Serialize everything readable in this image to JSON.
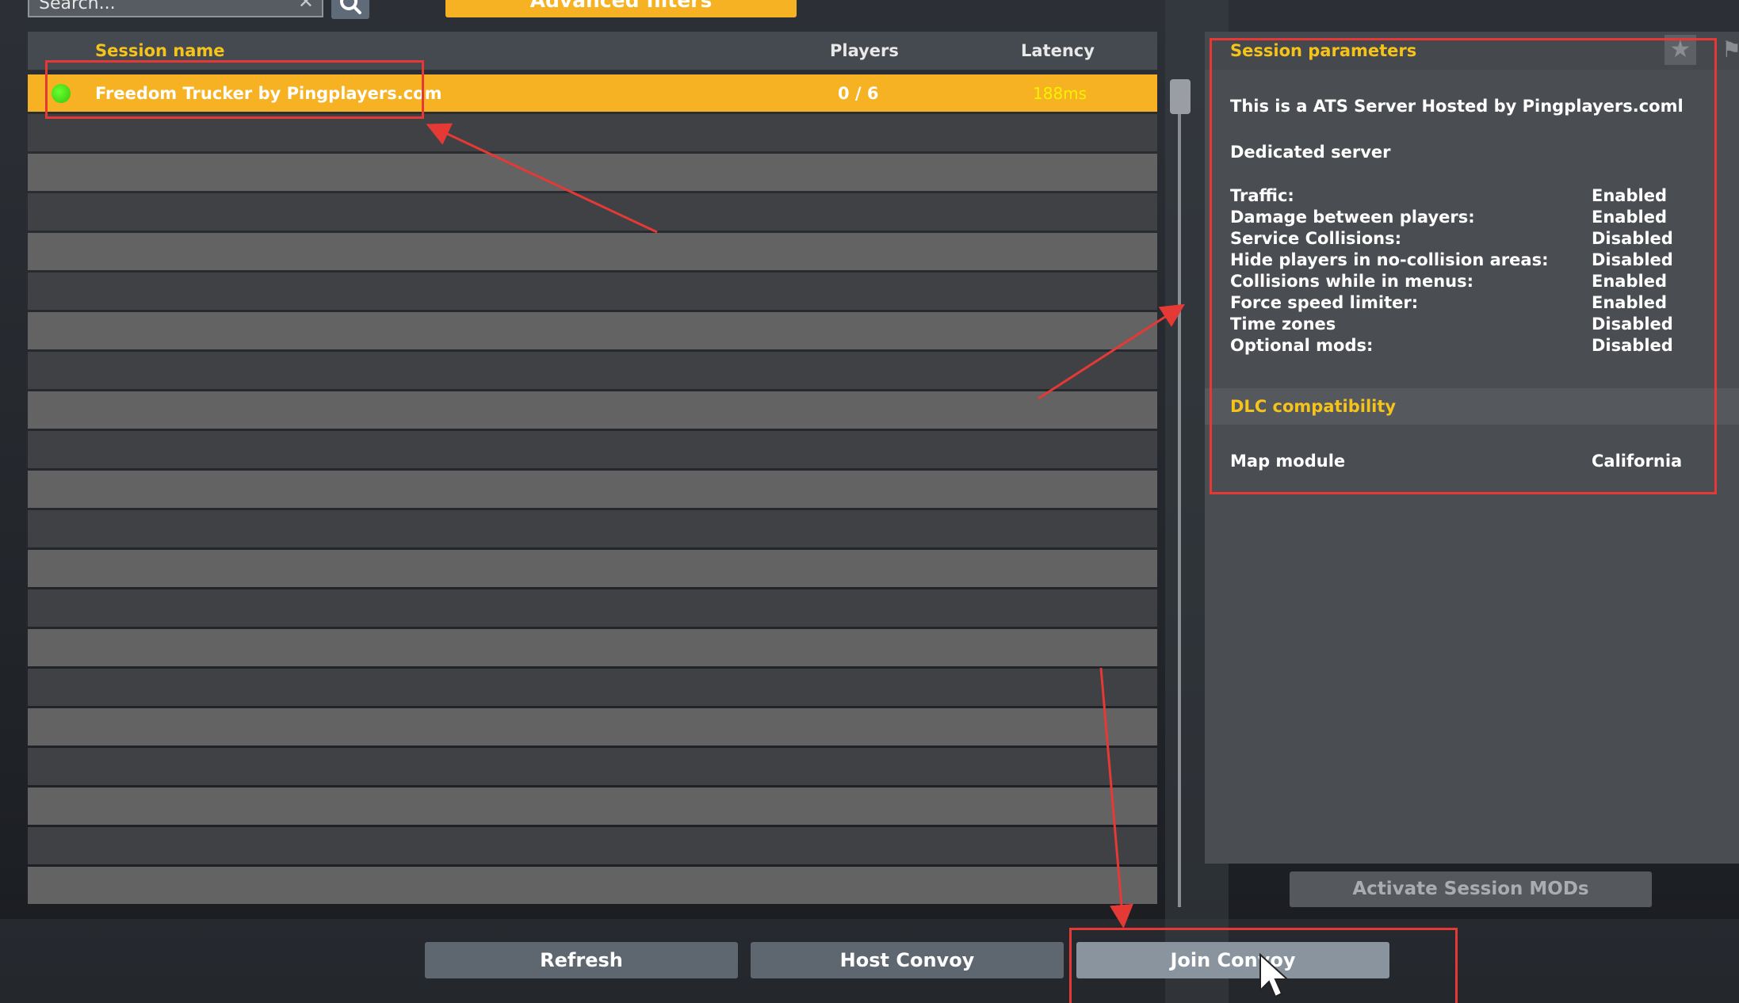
{
  "search": {
    "placeholder": "Search..."
  },
  "toolbar": {
    "advanced_filters_label": "Advanced filters"
  },
  "list": {
    "headers": {
      "name": "Session name",
      "players": "Players",
      "latency": "Latency"
    },
    "sessions": [
      {
        "name": "Freedom Trucker by Pingplayers.com",
        "players": "0 / 6",
        "latency": "188ms",
        "status": "online"
      }
    ]
  },
  "panel": {
    "title": "Session parameters",
    "description": "This is a ATS Server Hosted by Pingplayers.coml",
    "server_type": "Dedicated server",
    "params": [
      {
        "label": "Traffic:",
        "value": "Enabled"
      },
      {
        "label": "Damage between players:",
        "value": "Enabled"
      },
      {
        "label": "Service Collisions:",
        "value": "Disabled"
      },
      {
        "label": "Hide players in no-collision areas:",
        "value": "Disabled"
      },
      {
        "label": "Collisions while in menus:",
        "value": "Enabled"
      },
      {
        "label": "Force speed limiter:",
        "value": "Enabled"
      },
      {
        "label": "Time zones",
        "value": "Disabled"
      },
      {
        "label": "Optional mods:",
        "value": "Disabled"
      }
    ],
    "dlc_title": "DLC compatibility",
    "dlc": [
      {
        "label": "Map module",
        "value": "California"
      }
    ],
    "activate_mods_label": "Activate Session MODs"
  },
  "buttons": {
    "refresh": "Refresh",
    "host": "Host Convoy",
    "join": "Join Convoy"
  },
  "colors": {
    "accent": "#f6b222",
    "title_yellow": "#f6c31a",
    "annotation_red": "#e53935",
    "status_online": "#44dd11"
  }
}
